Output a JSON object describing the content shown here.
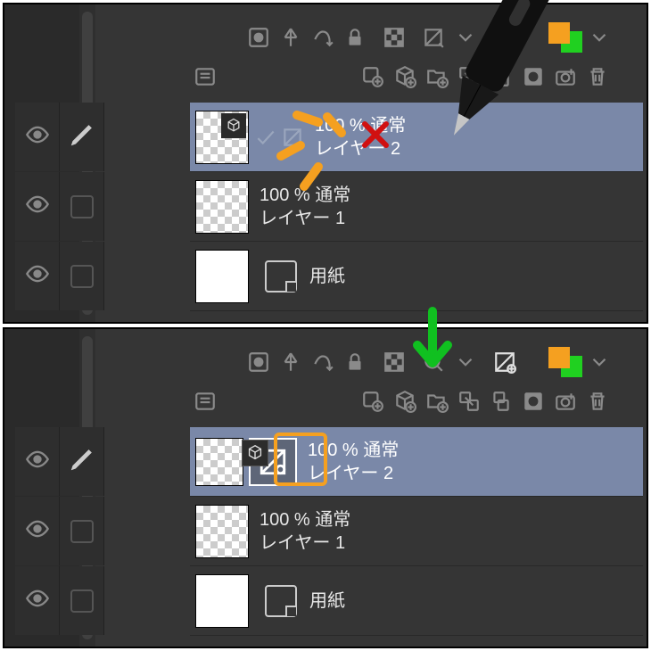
{
  "layers": {
    "layer2": {
      "opacity": "100 % 通常",
      "name": "レイヤー 2"
    },
    "layer1": {
      "opacity": "100 % 通常",
      "name": "レイヤー 1"
    },
    "paper": {
      "name": "用紙"
    }
  },
  "colors": {
    "fg": "#f5a020",
    "bg": "#20d020"
  }
}
